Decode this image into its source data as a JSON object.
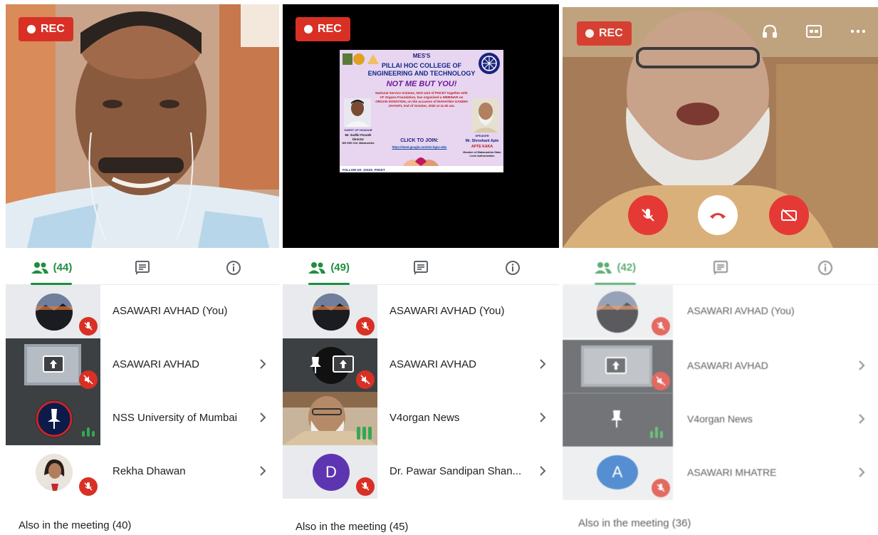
{
  "rec_label": "REC",
  "colors": {
    "rec": "#d93025",
    "active_tab": "#1e8e3e",
    "speaking": "#34a853"
  },
  "panels": [
    {
      "participants_count": "(44)",
      "participants": [
        {
          "name": "ASAWARI AVHAD (You)"
        },
        {
          "name": "ASAWARI AVHAD"
        },
        {
          "name": "NSS University of Mumbai"
        },
        {
          "name": "Rekha Dhawan"
        }
      ],
      "also_in_meeting": "Also in the meeting (40)"
    },
    {
      "participants_count": "(49)",
      "poster": {
        "org": "MES'S",
        "college": "PILLAI HOC COLLEGE OF",
        "college2": "ENGINEERING AND TECHNOLOGY",
        "headline": "NOT ME BUT YOU!",
        "description": "National Service Scheme, NSS Unit of PHCET together with VF Organs Foundation, has organized a WEBINAR on ORGAN DONATION, on the occasion of MAHATMA GANDHI JAYANTI, 2nd of October, 2020 at 11.00 am.",
        "click_to_join": "CLICK TO JOIN:",
        "link": "https://meet.google.com/xkr-hgnc-wbs",
        "guest_label": "GUEST OF HONOUR",
        "guest_name": "Mr. Sudhir Puranik",
        "guest_title": "Director",
        "guest_org": "MH NSS Cell, Maharashtra",
        "speaker_label": "SPEAKER",
        "speaker_name": "Mr. Shreekant Apte",
        "speaker_alias": "APTE KAKA",
        "speaker_title": "Member of Maharashtra State Level Authorization",
        "follow": "FOLLOW US: @NSS_PHCET"
      },
      "participants": [
        {
          "name": "ASAWARI AVHAD (You)"
        },
        {
          "name": "ASAWARI AVHAD"
        },
        {
          "name": "V4organ News"
        },
        {
          "name": "Dr. Pawar Sandipan Shan...",
          "initial": "D"
        }
      ],
      "also_in_meeting": "Also in the meeting (45)"
    },
    {
      "participants_count": "(42)",
      "participants": [
        {
          "name": "ASAWARI AVHAD (You)"
        },
        {
          "name": "ASAWARI AVHAD"
        },
        {
          "name": "V4organ News"
        },
        {
          "name": "ASAWARI MHATRE",
          "initial": "A"
        }
      ],
      "also_in_meeting": "Also in the meeting (36)"
    }
  ]
}
